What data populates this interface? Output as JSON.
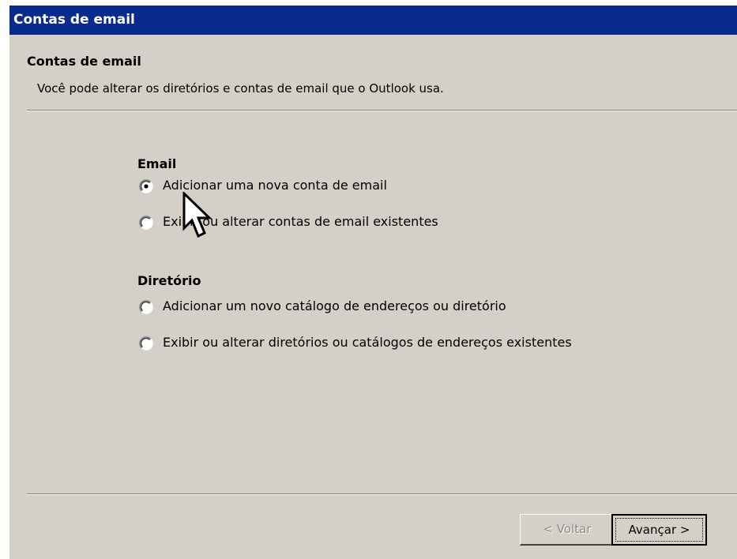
{
  "window": {
    "title": "Contas de email"
  },
  "header": {
    "title": "Contas de email",
    "subtitle": "Você pode alterar os diretórios e contas de email que o Outlook usa."
  },
  "email_group": {
    "label": "Email",
    "options": [
      {
        "label": "Adicionar uma nova conta de email",
        "selected": true
      },
      {
        "label": "Exibir ou alterar contas de email existentes",
        "selected": false
      }
    ]
  },
  "directory_group": {
    "label": "Diretório",
    "options": [
      {
        "label": "Adicionar um novo catálogo de endereços ou diretório",
        "selected": false
      },
      {
        "label": "Exibir ou alterar diretórios ou catálogos de endereços existentes",
        "selected": false
      }
    ]
  },
  "buttons": {
    "back_label": "< Voltar",
    "back_enabled": false,
    "next_label": "Avançar >"
  },
  "colors": {
    "titlebar": "#0a2a8e",
    "dialog_face": "#d4d0c8"
  }
}
